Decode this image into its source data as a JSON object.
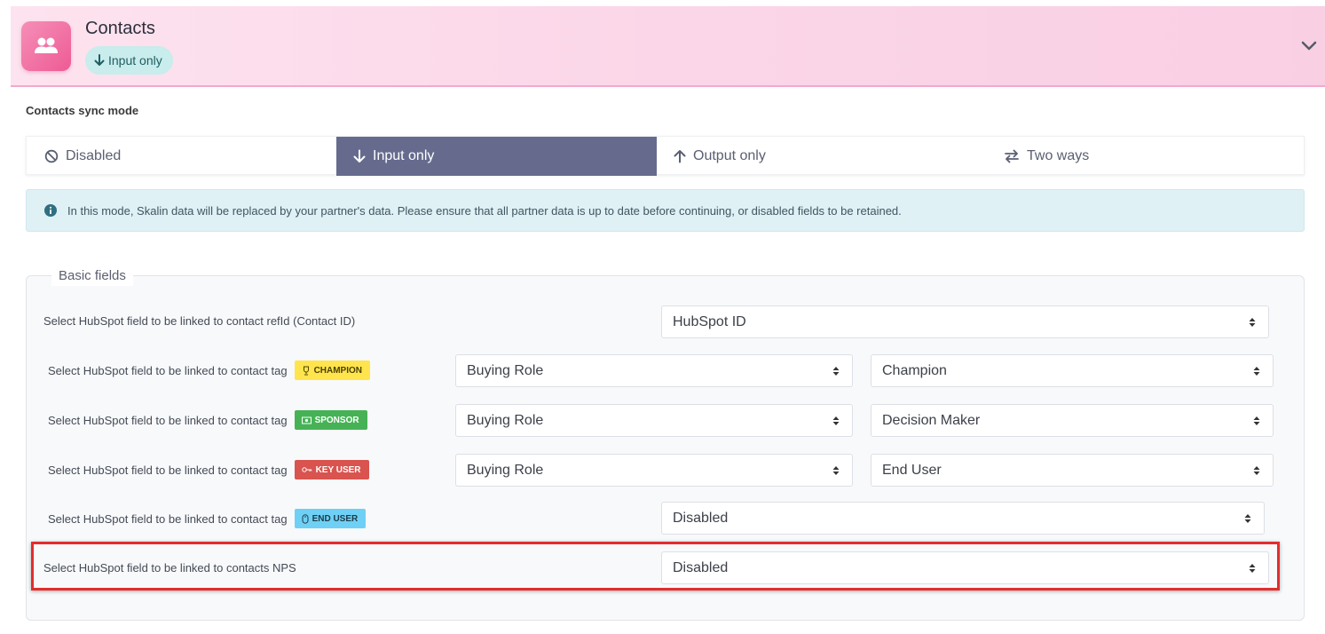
{
  "header": {
    "title": "Contacts",
    "badge": "Input only"
  },
  "sync": {
    "label": "Contacts sync mode",
    "tabs": [
      {
        "label": "Disabled"
      },
      {
        "label": "Input only",
        "active": true
      },
      {
        "label": "Output only"
      },
      {
        "label": "Two ways"
      }
    ]
  },
  "info": {
    "text": "In this mode, Skalin data will be replaced by your partner's data. Please ensure that all partner data is up to date before continuing, or disabled fields to be retained."
  },
  "basic_fields": {
    "legend": "Basic fields",
    "rows": [
      {
        "label": "Select HubSpot field to be linked to contact refId (Contact ID)",
        "select1": "HubSpot ID"
      },
      {
        "label": "Select HubSpot field to be linked to contact tag",
        "tag": "CHAMPION",
        "select1": "Buying Role",
        "select2": "Champion"
      },
      {
        "label": "Select HubSpot field to be linked to contact tag",
        "tag": "SPONSOR",
        "select1": "Buying Role",
        "select2": "Decision Maker"
      },
      {
        "label": "Select HubSpot field to be linked to contact tag",
        "tag": "KEY USER",
        "select1": "Buying Role",
        "select2": "End User"
      },
      {
        "label": "Select HubSpot field to be linked to contact tag",
        "tag": "END USER",
        "select1": "Disabled"
      },
      {
        "label": "Select HubSpot field to be linked to contacts NPS",
        "select1": "Disabled"
      }
    ]
  },
  "colors": {
    "active_tab": "#666b8e",
    "highlight": "#e32d2d",
    "champion": "#ffe44d",
    "sponsor": "#46b255",
    "key_user": "#d9534f",
    "end_user": "#6fd0f5"
  }
}
